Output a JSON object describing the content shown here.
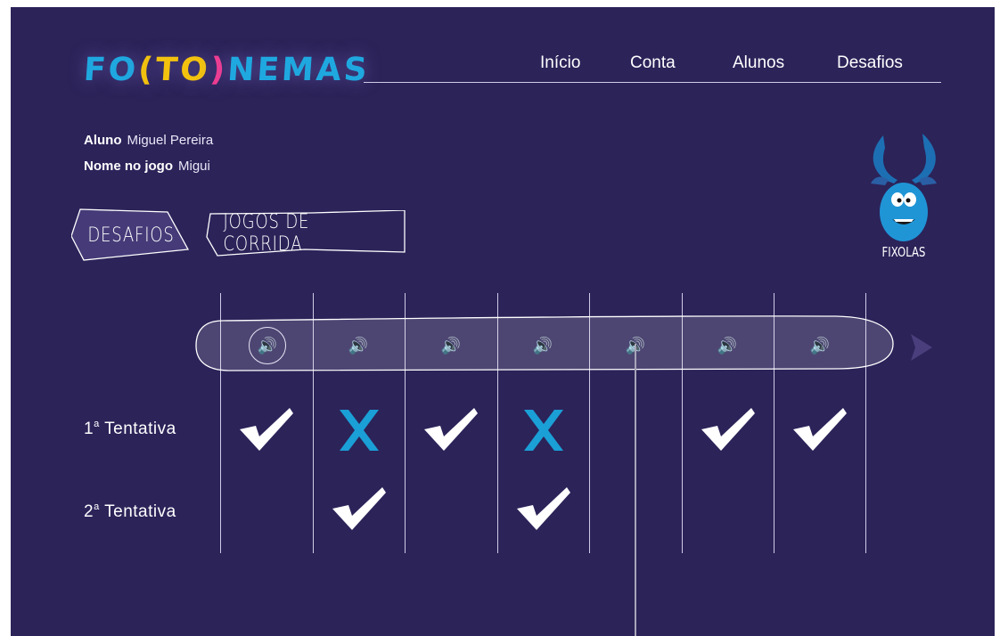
{
  "app": {
    "logo": [
      "FO",
      "(",
      "TO",
      ")",
      "NEMAS"
    ],
    "logo_colors": [
      "#1fa8e0",
      "#f2c20f",
      "#f2c20f",
      "#ee3d92",
      "#1fa8e0"
    ],
    "nav": [
      "Início",
      "Conta",
      "Alunos",
      "Desafios"
    ]
  },
  "student": {
    "aluno_label": "Aluno",
    "aluno_value": "Miguel Pereira",
    "nome_label": "Nome no jogo",
    "nome_value": "Migui"
  },
  "tabs": {
    "desafios": "DESAFIOS",
    "jogos": "JOGOS DE CORRIDA"
  },
  "mascot": {
    "name": "FIXOLAS",
    "color": "#1f95d6"
  },
  "rows": {
    "first": {
      "label": "1",
      "sup": "a",
      "rest": "Tentativa"
    },
    "second": {
      "label": "2",
      "sup": "a",
      "rest": "Tentativa"
    }
  },
  "challenges": [
    {
      "sound_icon": "speaker-icon",
      "selected": true,
      "first": "correct",
      "second": ""
    },
    {
      "sound_icon": "speaker-icon",
      "selected": false,
      "first": "wrong",
      "second": "correct"
    },
    {
      "sound_icon": "speaker-icon",
      "selected": false,
      "first": "correct",
      "second": ""
    },
    {
      "sound_icon": "speaker-icon",
      "selected": false,
      "first": "wrong",
      "second": "correct"
    },
    {
      "sound_icon": "speaker-icon",
      "selected": false,
      "first": "",
      "second": ""
    },
    {
      "sound_icon": "speaker-icon",
      "selected": false,
      "first": "correct",
      "second": ""
    },
    {
      "sound_icon": "speaker-icon",
      "selected": false,
      "first": "correct",
      "second": ""
    }
  ],
  "colors": {
    "background": "#2c2359",
    "correct": "#ffffff",
    "wrong": "#1a9fd6",
    "next_arrow": "#4a3f7c"
  }
}
